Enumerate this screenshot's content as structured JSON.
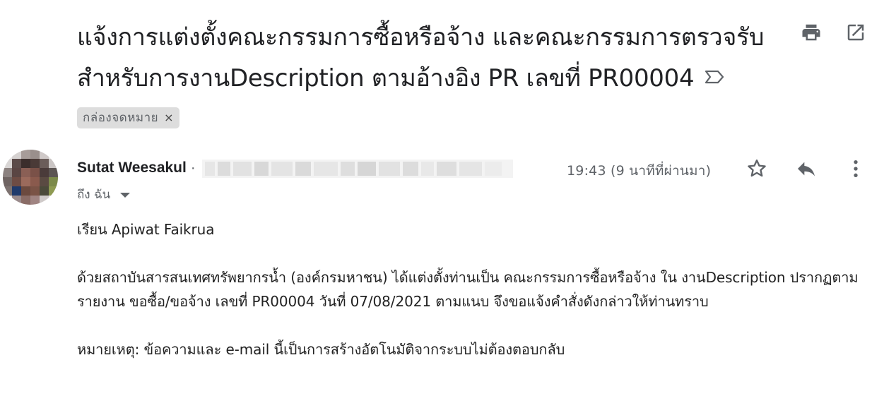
{
  "email": {
    "subject": "แจ้งการแต่งตั้งคณะกรรมการซื้อหรือจ้าง และคณะกรรมการตรวจรับ สำหรับการงานDescription ตามอ้างอิง PR เลขที่ PR00004",
    "label": "กล่องจดหมาย",
    "label_close": "×",
    "sender_name": "Sutat Weesakul",
    "sender_separator": "·",
    "to_line": "ถึง ฉัน",
    "timestamp": "19:43 (9 นาทีที่ผ่านมา)",
    "greeting": "เรียน Apiwat Faikrua",
    "paragraph_1": "ด้วยสถาบันสารสนเทศทรัพยากรน้ำ (องค์กรมหาชน) ได้แต่งตั้งท่านเป็น คณะกรรมการซื้อหรือจ้าง ใน งานDescription ปรากฏตามรายงาน ขอซื้อ/ขอจ้าง เลขที่ PR00004 วันที่ 07/08/2021 ตามแนบ จึงขอแจ้งคำสั่งดังกล่าวให้ท่านทราบ",
    "note": "หมายเหตุ: ข้อความและ e-mail นี้เป็นการสร้างอัตโนมัติจากระบบไม่ต้องตอบกลับ"
  },
  "icons": {
    "print": "print-icon",
    "open_new_window": "open-in-new-window-icon",
    "important_marker": "label-important-icon",
    "star": "star-icon",
    "reply": "reply-icon",
    "more": "more-vertical-icon",
    "dropdown": "chevron-down-icon"
  },
  "colors": {
    "text_primary": "#202124",
    "text_secondary": "#5f6368",
    "icon_gray": "#5f6368",
    "chip_bg": "#dddddd"
  }
}
